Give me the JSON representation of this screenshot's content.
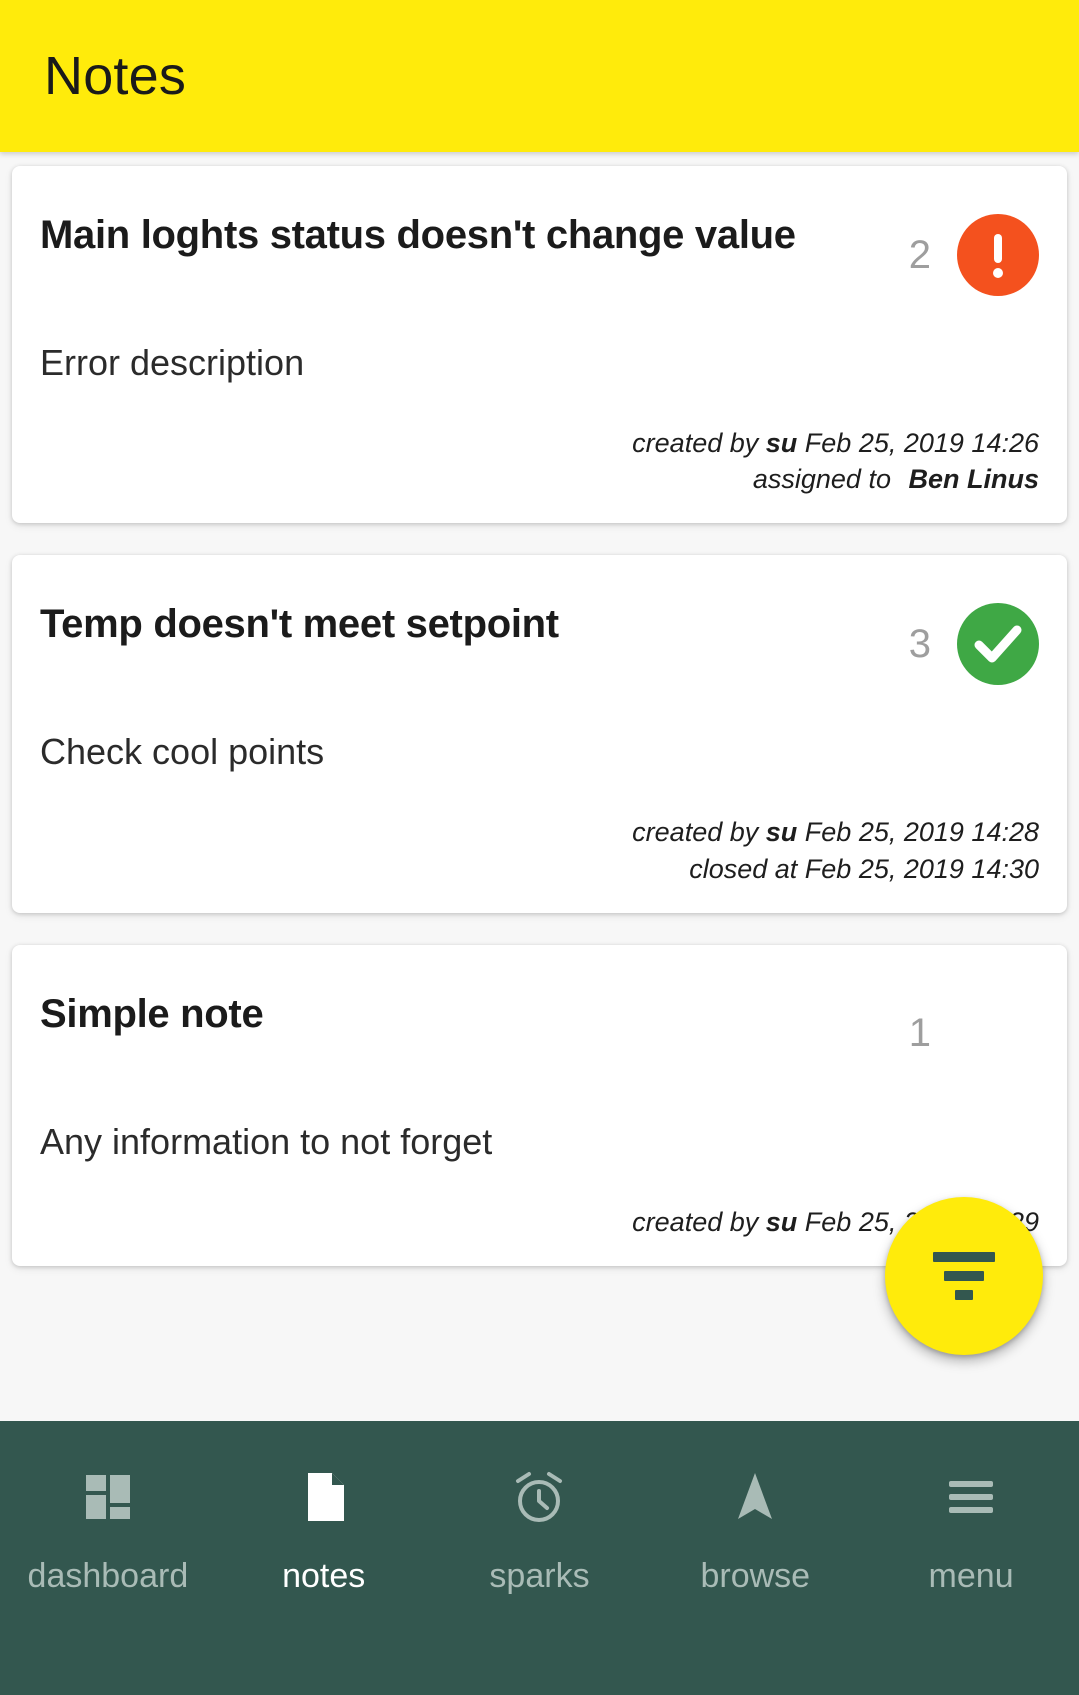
{
  "app": {
    "title": "Notes",
    "header_bg": "#ffeb0b",
    "accent_yellow": "#ffeb0b",
    "nav_bg": "#33574f",
    "error_color": "#f4511e",
    "done_color": "#3fa845"
  },
  "notes": [
    {
      "title": "Main loghts status doesn't change value",
      "count": "2",
      "status": "error",
      "description": "Error description",
      "meta": [
        {
          "prefix": "created by",
          "strong": "su",
          "suffix": "Feb 25, 2019 14:26"
        },
        {
          "prefix": "assigned to",
          "name": "Ben Linus"
        }
      ]
    },
    {
      "title": "Temp doesn't meet setpoint",
      "count": "3",
      "status": "done",
      "description": "Check cool points",
      "meta": [
        {
          "prefix": "created by",
          "strong": "su",
          "suffix": "Feb 25, 2019 14:28"
        },
        {
          "prefix": "closed at",
          "suffix": "Feb 25, 2019 14:30"
        }
      ]
    },
    {
      "title": "Simple note",
      "count": "1",
      "status": "none",
      "description": "Any information to not forget",
      "meta": [
        {
          "prefix": "created by",
          "strong": "su",
          "suffix": "Feb 25, 2019 14:29"
        }
      ]
    }
  ],
  "fab": {
    "icon": "filter-icon",
    "label": "filter"
  },
  "bottom_nav": {
    "active_index": 1,
    "items": [
      {
        "label": "dashboard",
        "icon": "dashboard-grid-icon"
      },
      {
        "label": "notes",
        "icon": "document-icon"
      },
      {
        "label": "sparks",
        "icon": "alarm-clock-icon"
      },
      {
        "label": "browse",
        "icon": "navigation-arrow-icon"
      },
      {
        "label": "menu",
        "icon": "hamburger-menu-icon"
      }
    ]
  }
}
